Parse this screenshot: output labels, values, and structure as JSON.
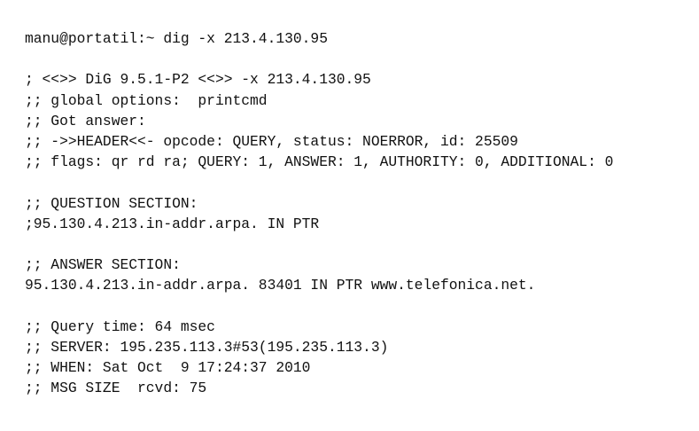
{
  "terminal": {
    "prompt_line": "manu@portatil:~ dig -x 213.4.130.95",
    "header": {
      "banner": "; <<>> DiG 9.5.1-P2 <<>> -x 213.4.130.95",
      "global_options": ";; global options:  printcmd",
      "got_answer": ";; Got answer:",
      "header_line": ";; ->>HEADER<<- opcode: QUERY, status: NOERROR, id: 25509",
      "flags_line": ";; flags: qr rd ra; QUERY: 1, ANSWER: 1, AUTHORITY: 0, ADDITIONAL: 0"
    },
    "question": {
      "title": ";; QUESTION SECTION:",
      "record": ";95.130.4.213.in-addr.arpa. IN PTR"
    },
    "answer": {
      "title": ";; ANSWER SECTION:",
      "record": "95.130.4.213.in-addr.arpa. 83401 IN PTR www.telefonica.net."
    },
    "stats": {
      "query_time": ";; Query time: 64 msec",
      "server": ";; SERVER: 195.235.113.3#53(195.235.113.3)",
      "when": ";; WHEN: Sat Oct  9 17:24:37 2010",
      "msg_size": ";; MSG SIZE  rcvd: 75"
    }
  }
}
